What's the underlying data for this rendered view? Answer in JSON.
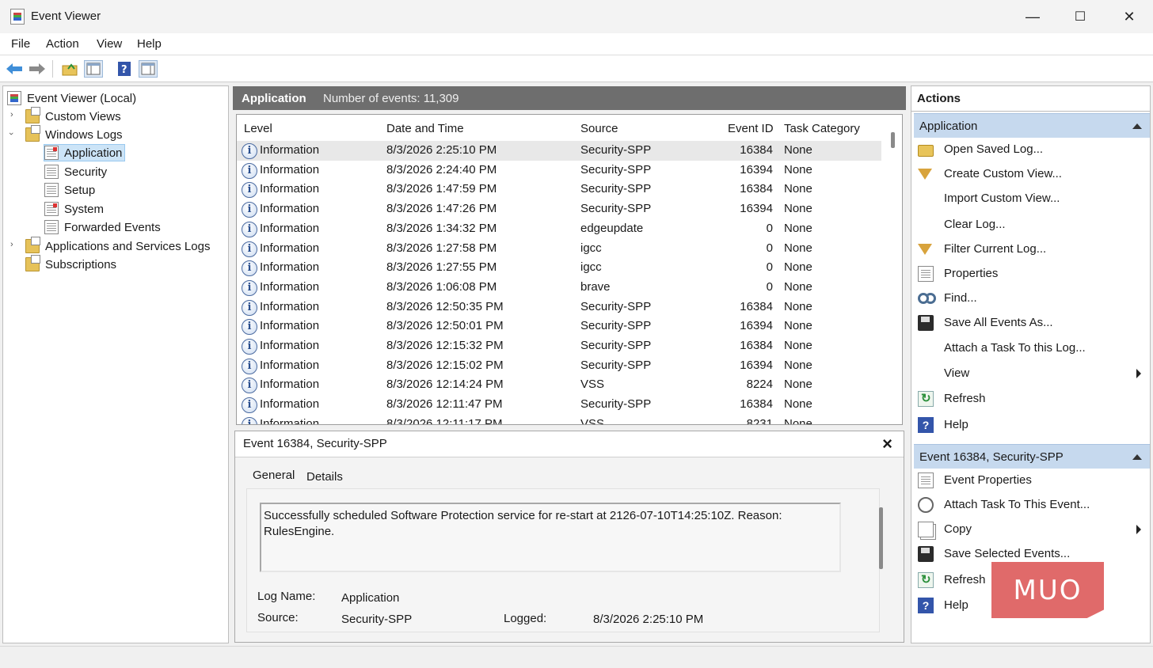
{
  "window": {
    "title": "Event Viewer",
    "minimize": "—",
    "maximize": "☐",
    "close": "✕"
  },
  "menu": [
    "File",
    "Action",
    "View",
    "Help"
  ],
  "tree": {
    "root": "Event Viewer (Local)",
    "custom_views": "Custom Views",
    "windows_logs": "Windows Logs",
    "logs": [
      "Application",
      "Security",
      "Setup",
      "System",
      "Forwarded Events"
    ],
    "app_services": "Applications and Services Logs",
    "subscriptions": "Subscriptions"
  },
  "center": {
    "log_name": "Application",
    "event_count": "Number of events: 11,309",
    "columns": [
      "Level",
      "Date and Time",
      "Source",
      "Event ID",
      "Task Category"
    ],
    "rows": [
      {
        "level": "Information",
        "datetime": "8/3/2026 2:25:10 PM",
        "source": "Security-SPP",
        "event_id": "16384",
        "category": "None"
      },
      {
        "level": "Information",
        "datetime": "8/3/2026 2:24:40 PM",
        "source": "Security-SPP",
        "event_id": "16394",
        "category": "None"
      },
      {
        "level": "Information",
        "datetime": "8/3/2026 1:47:59 PM",
        "source": "Security-SPP",
        "event_id": "16384",
        "category": "None"
      },
      {
        "level": "Information",
        "datetime": "8/3/2026 1:47:26 PM",
        "source": "Security-SPP",
        "event_id": "16394",
        "category": "None"
      },
      {
        "level": "Information",
        "datetime": "8/3/2026 1:34:32 PM",
        "source": "edgeupdate",
        "event_id": "0",
        "category": "None"
      },
      {
        "level": "Information",
        "datetime": "8/3/2026 1:27:58 PM",
        "source": "igcc",
        "event_id": "0",
        "category": "None"
      },
      {
        "level": "Information",
        "datetime": "8/3/2026 1:27:55 PM",
        "source": "igcc",
        "event_id": "0",
        "category": "None"
      },
      {
        "level": "Information",
        "datetime": "8/3/2026 1:06:08 PM",
        "source": "brave",
        "event_id": "0",
        "category": "None"
      },
      {
        "level": "Information",
        "datetime": "8/3/2026 12:50:35 PM",
        "source": "Security-SPP",
        "event_id": "16384",
        "category": "None"
      },
      {
        "level": "Information",
        "datetime": "8/3/2026 12:50:01 PM",
        "source": "Security-SPP",
        "event_id": "16394",
        "category": "None"
      },
      {
        "level": "Information",
        "datetime": "8/3/2026 12:15:32 PM",
        "source": "Security-SPP",
        "event_id": "16384",
        "category": "None"
      },
      {
        "level": "Information",
        "datetime": "8/3/2026 12:15:02 PM",
        "source": "Security-SPP",
        "event_id": "16394",
        "category": "None"
      },
      {
        "level": "Information",
        "datetime": "8/3/2026 12:14:24 PM",
        "source": "VSS",
        "event_id": "8224",
        "category": "None"
      },
      {
        "level": "Information",
        "datetime": "8/3/2026 12:11:47 PM",
        "source": "Security-SPP",
        "event_id": "16384",
        "category": "None"
      },
      {
        "level": "Information",
        "datetime": "8/3/2026 12:11:17 PM",
        "source": "VSS",
        "event_id": "8231",
        "category": "None"
      }
    ]
  },
  "detail": {
    "title": "Event 16384, Security-SPP",
    "close": "×",
    "tabs": [
      "General",
      "Details"
    ],
    "message": "Successfully scheduled Software Protection service for re-start at 2126-07-10T14:25:10Z. Reason: RulesEngine.",
    "log_name_label": "Log Name:",
    "log_name_value": "Application",
    "source_label": "Source:",
    "source_value": "Security-SPP",
    "logged_label": "Logged:",
    "logged_value": "8/3/2026 2:25:10 PM"
  },
  "actions": {
    "title": "Actions",
    "section1": "Application",
    "items1": [
      "Open Saved Log...",
      "Create Custom View...",
      "Import Custom View...",
      "Clear Log...",
      "Filter Current Log...",
      "Properties",
      "Find...",
      "Save All Events As...",
      "Attach a Task To this Log...",
      "View",
      "Refresh",
      "Help"
    ],
    "section2": "Event 16384, Security-SPP",
    "items2": [
      "Event Properties",
      "Attach Task To This Event...",
      "Copy",
      "Save Selected Events...",
      "Refresh",
      "Help"
    ]
  },
  "watermark": "MUO"
}
